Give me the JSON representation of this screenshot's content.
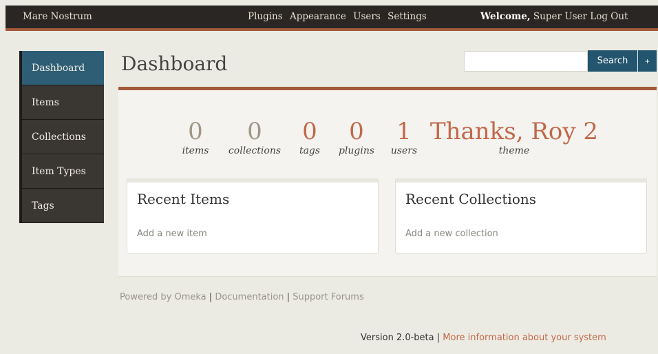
{
  "header": {
    "site_title": "Mare Nostrum",
    "global_nav": [
      "Plugins",
      "Appearance",
      "Users",
      "Settings"
    ],
    "welcome": "Welcome,",
    "user_name": "Super User",
    "logout": "Log Out"
  },
  "sidebar": {
    "items": [
      {
        "label": "Dashboard"
      },
      {
        "label": "Items"
      },
      {
        "label": "Collections"
      },
      {
        "label": "Item Types"
      },
      {
        "label": "Tags"
      }
    ]
  },
  "page": {
    "title": "Dashboard"
  },
  "search": {
    "value": "",
    "placeholder": "",
    "button": "Search",
    "advanced": "+"
  },
  "stats": [
    {
      "value": "0",
      "label": "items"
    },
    {
      "value": "0",
      "label": "collections"
    },
    {
      "value": "0",
      "label": "tags"
    },
    {
      "value": "0",
      "label": "plugins"
    },
    {
      "value": "1",
      "label": "users"
    },
    {
      "value": "Thanks, Roy 2",
      "label": "theme"
    }
  ],
  "recent_items": {
    "title": "Recent Items",
    "link": "Add a new item"
  },
  "recent_collections": {
    "title": "Recent Collections",
    "link": "Add a new collection"
  },
  "footer": {
    "powered": "Powered by Omeka",
    "sep": "|",
    "documentation": "Documentation",
    "forums": "Support Forums",
    "version": "Version 2.0-beta",
    "more_info": "More information about your system"
  },
  "colors": {
    "accent": "#a35a3a",
    "active_nav": "#2e5e75",
    "stat_highlight": "#c0694a"
  }
}
